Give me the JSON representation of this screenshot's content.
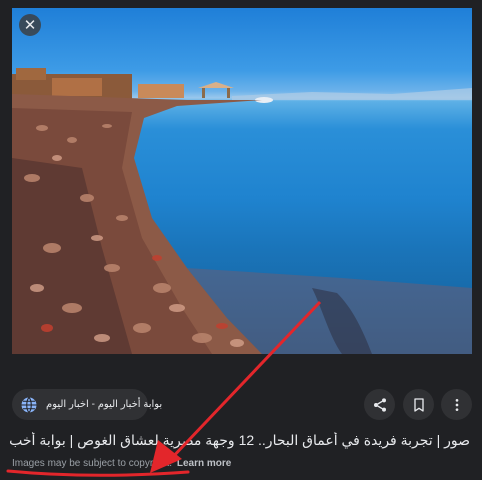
{
  "photo": {
    "alt": ""
  },
  "close_button": {
    "glyph": "✕",
    "icon": "close-icon"
  },
  "source": {
    "label": "بوابة أخبار اليوم - اخبار اليوم",
    "icon": "globe-icon"
  },
  "actions": [
    {
      "name": "share",
      "icon": "share-icon"
    },
    {
      "name": "save",
      "icon": "bookmark-icon"
    },
    {
      "name": "more",
      "icon": "more-vert-icon"
    }
  ],
  "title": "صور | تجربة فريدة في أعماق البحار.. 12 وجهة مصرية لعشاق الغوص | بوابة أخب",
  "copyright": {
    "text": "Images may be subject to copyright.",
    "link": "Learn more"
  },
  "colors": {
    "background": "#202124",
    "annotation": "#e3262b"
  }
}
